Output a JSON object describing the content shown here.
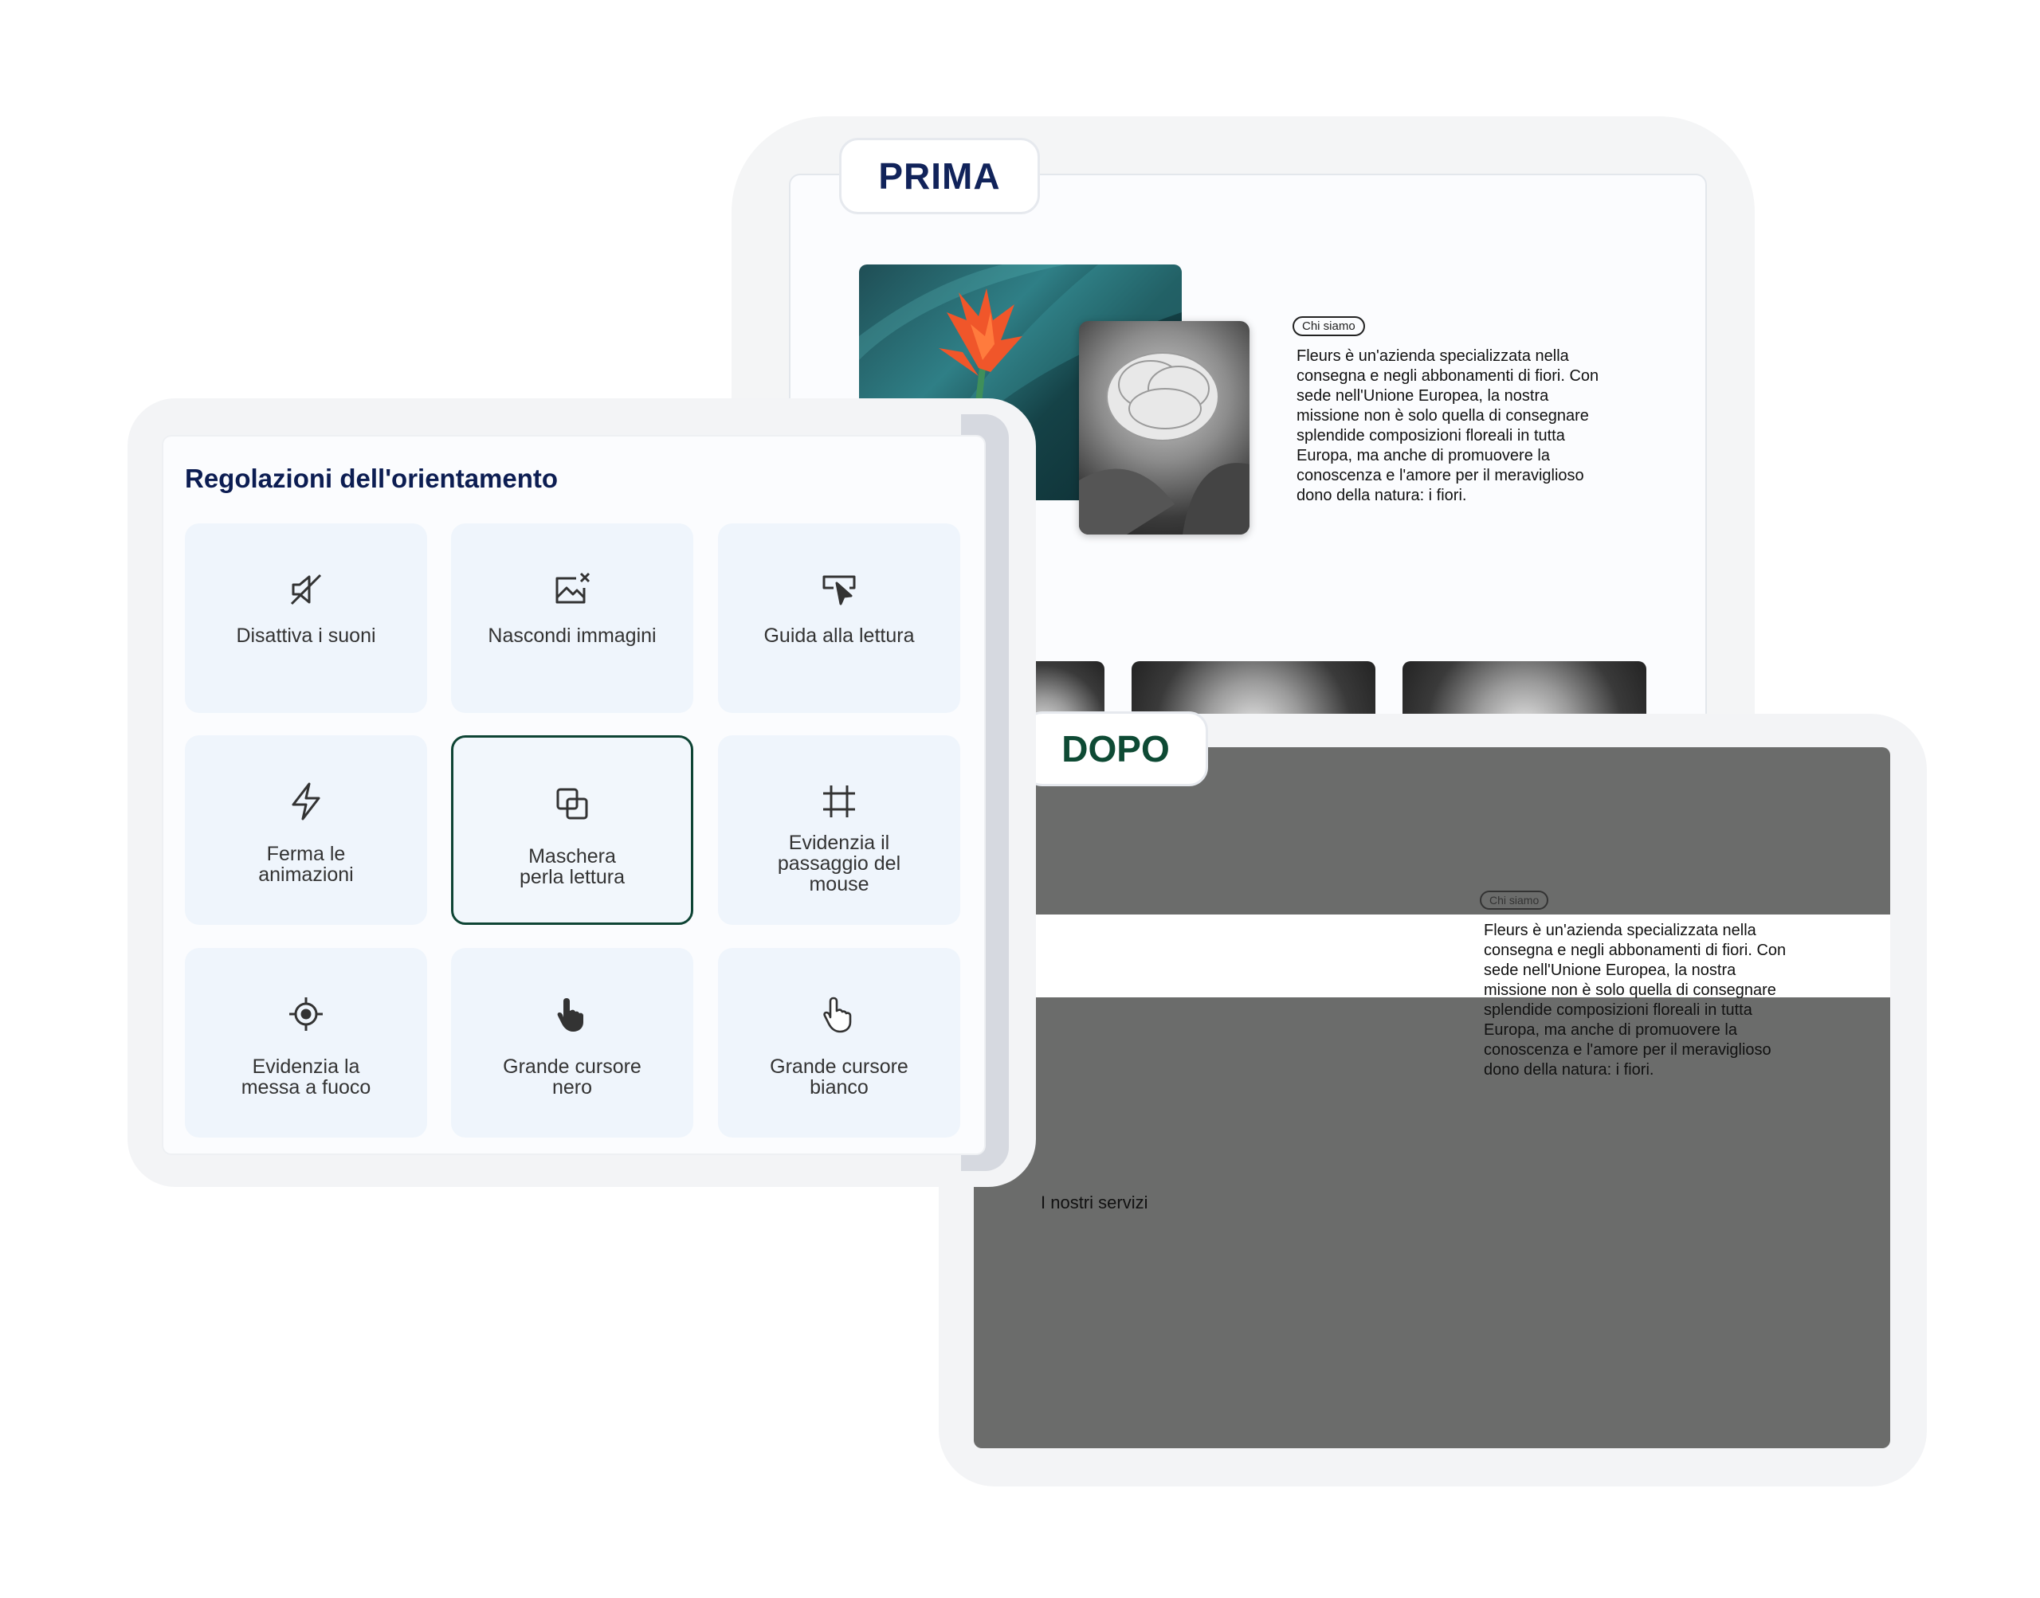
{
  "prima": {
    "label": "PRIMA",
    "about_pill": "Chi siamo",
    "about_text_lines": [
      "Fleurs è un'azienda specializzata nella",
      "consegna e negli abbonamenti di fiori. Con",
      "sede nell'Unione Europea, la nostra",
      "missione non è solo quella di consegnare",
      "splendide composizioni floreali in tutta",
      "Europa, ma anche di promuovere la",
      "conoscenza e l'amore per il meraviglioso",
      "dono della natura: i fiori."
    ]
  },
  "panel": {
    "title": "Regolazioni dell'orientamento",
    "tiles": [
      {
        "label": "Disattiva i suoni",
        "icon": "mute-icon"
      },
      {
        "label": "Nascondi immagini",
        "icon": "hide-image-icon"
      },
      {
        "label": "Guida alla lettura",
        "icon": "reading-guide-icon"
      },
      {
        "label": "Ferma le animazioni",
        "icon": "lightning-icon"
      },
      {
        "label": "Maschera perla lettura",
        "icon": "reading-mask-icon"
      },
      {
        "label": "Evidenzia il passaggio del mouse",
        "icon": "hover-highlight-icon"
      },
      {
        "label": "Evidenzia la messa a fuoco",
        "icon": "focus-target-icon"
      },
      {
        "label": "Grande cursore nero",
        "icon": "black-cursor-icon"
      },
      {
        "label": "Grande cursore bianco",
        "icon": "white-cursor-icon"
      }
    ]
  },
  "dopo": {
    "label": "DOPO",
    "about_pill": "Chi siamo",
    "services": "I nostri servizi"
  }
}
